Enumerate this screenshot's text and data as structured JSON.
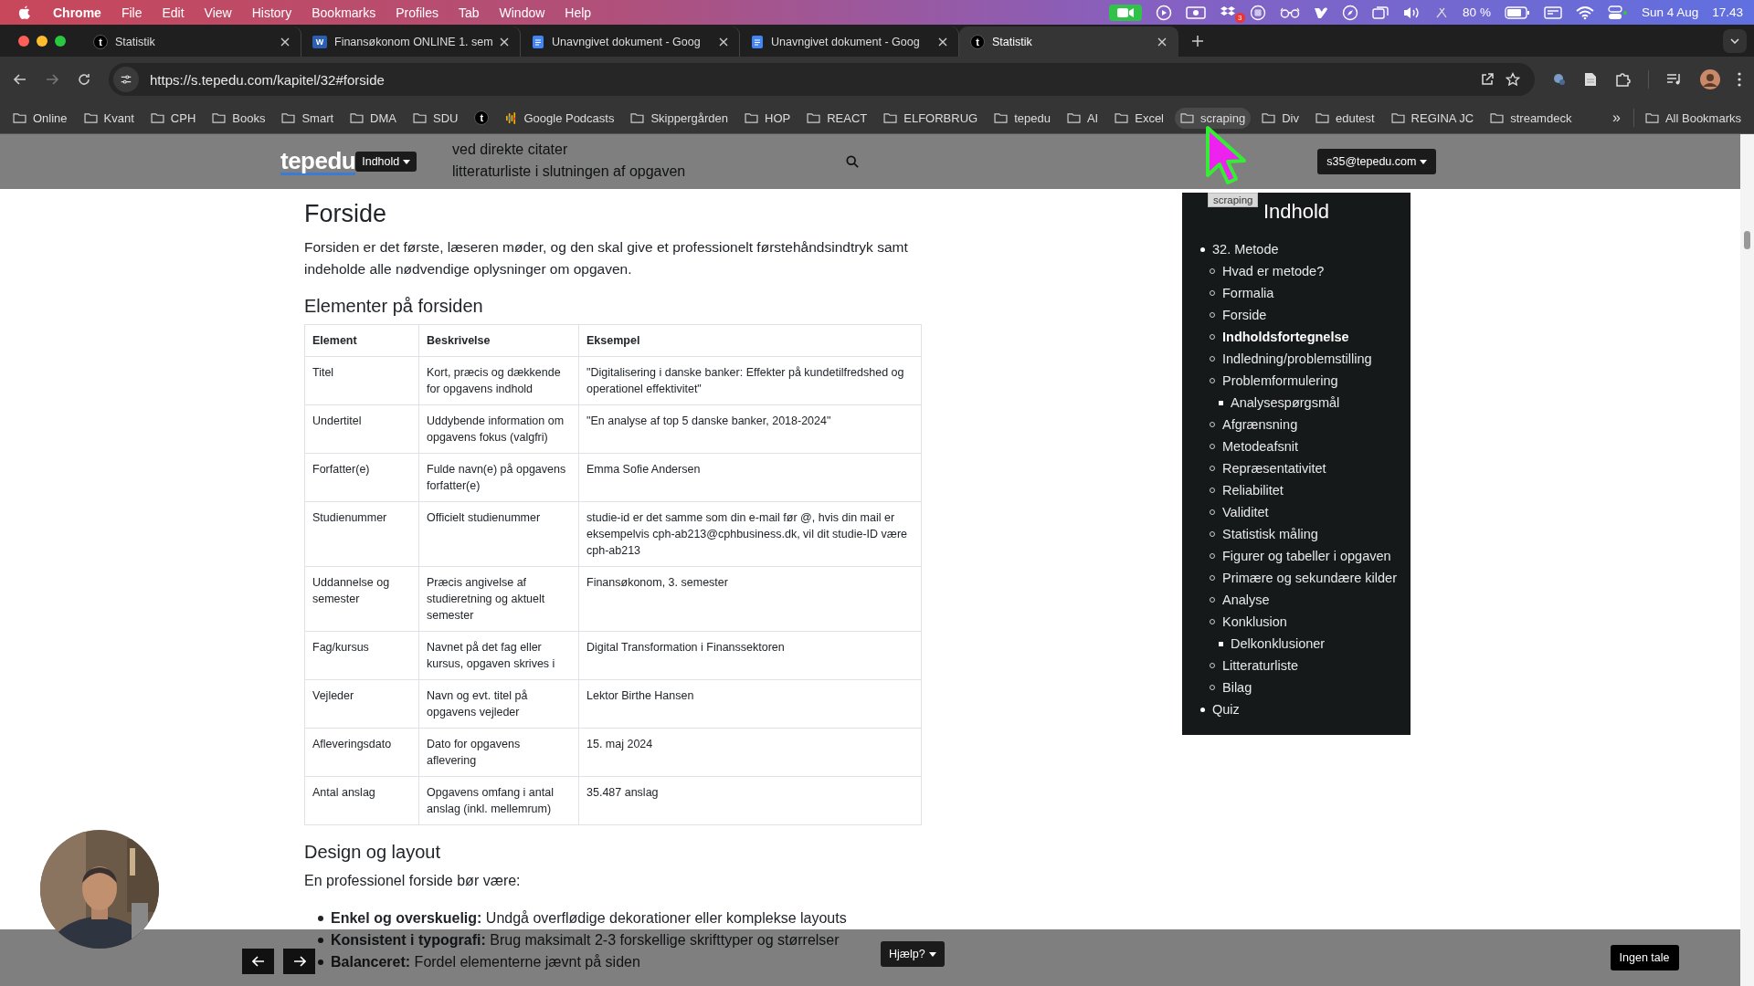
{
  "menu_bar": {
    "app": "Chrome",
    "menus": [
      "File",
      "Edit",
      "View",
      "History",
      "Bookmarks",
      "Profiles",
      "Tab",
      "Window",
      "Help"
    ],
    "badge": "3",
    "battery": "80 %",
    "date": "Sun 4 Aug",
    "time": "17.43"
  },
  "tabs": [
    {
      "title": "Statistik",
      "kind": "letter",
      "letter": "t",
      "selected": false
    },
    {
      "title": "Finansøkonom ONLINE 1. sem",
      "kind": "word",
      "letter": "W",
      "selected": false
    },
    {
      "title": "Unavngivet dokument - Goog",
      "kind": "docs",
      "selected": false
    },
    {
      "title": "Unavngivet dokument - Goog",
      "kind": "docs",
      "selected": false
    },
    {
      "title": "Statistik",
      "kind": "letter",
      "letter": "t",
      "selected": true
    }
  ],
  "toolbar": {
    "url": "https://s.tepedu.com/kapitel/32#forside"
  },
  "bookmarks": [
    {
      "label": "Online",
      "kind": "folder",
      "hovered": false
    },
    {
      "label": "Kvant",
      "kind": "folder",
      "hovered": false
    },
    {
      "label": "CPH",
      "kind": "folder",
      "hovered": false
    },
    {
      "label": "Books",
      "kind": "folder",
      "hovered": false
    },
    {
      "label": "Smart",
      "kind": "folder",
      "hovered": false
    },
    {
      "label": "DMA",
      "kind": "folder",
      "hovered": false
    },
    {
      "label": "SDU",
      "kind": "folder",
      "hovered": false
    },
    {
      "label": "t",
      "kind": "letter",
      "hovered": false
    },
    {
      "label": "Google Podcasts",
      "kind": "podcast",
      "hovered": false
    },
    {
      "label": "Skippergården",
      "kind": "folder",
      "hovered": false
    },
    {
      "label": "HOP",
      "kind": "folder",
      "hovered": false
    },
    {
      "label": "REACT",
      "kind": "folder",
      "hovered": false
    },
    {
      "label": "ELFORBRUG",
      "kind": "folder",
      "hovered": false
    },
    {
      "label": "tepedu",
      "kind": "folder",
      "hovered": false
    },
    {
      "label": "AI",
      "kind": "folder",
      "hovered": false
    },
    {
      "label": "Excel",
      "kind": "folder",
      "hovered": false
    },
    {
      "label": "scraping",
      "kind": "folder",
      "hovered": true
    },
    {
      "label": "Div",
      "kind": "folder",
      "hovered": false
    },
    {
      "label": "edutest",
      "kind": "folder",
      "hovered": false
    },
    {
      "label": "REGINA JC",
      "kind": "folder",
      "hovered": false
    },
    {
      "label": "streamdeck",
      "kind": "folder",
      "hovered": false
    }
  ],
  "bookmarks_overflow": "»",
  "all_bookmarks": "All Bookmarks",
  "tooltip": "scraping",
  "site_header": {
    "logo": "tepedu",
    "menu_button": "Indhold",
    "user_button": "s35@tepedu.com"
  },
  "article": {
    "top_bullets": [
      "ved direkte citater",
      "litteraturliste i slutningen af opgaven"
    ],
    "title": "Forside",
    "intro": "Forsiden er det første, læseren møder, og den skal give et professionelt førstehåndsindtryk samt indeholde alle nødvendige oplysninger om opgaven.",
    "table_heading": "Elementer på forsiden",
    "table": {
      "columns": [
        "Element",
        "Beskrivelse",
        "Eksempel"
      ],
      "rows": [
        [
          "Titel",
          "Kort, præcis og dækkende for opgavens indhold",
          "\"Digitalisering i danske banker: Effekter på kundetilfredshed og operationel effektivitet\""
        ],
        [
          "Undertitel",
          "Uddybende information om opgavens fokus (valgfri)",
          "\"En analyse af top 5 danske banker, 2018-2024\""
        ],
        [
          "Forfatter(e)",
          "Fulde navn(e) på opgavens forfatter(e)",
          "Emma Sofie Andersen"
        ],
        [
          "Studienummer",
          "Officielt studienummer",
          "studie-id er det samme som din e-mail før @, hvis din mail er eksempelvis cph-ab213@cphbusiness.dk, vil dit studie-ID være cph-ab213"
        ],
        [
          "Uddannelse og semester",
          "Præcis angivelse af studieretning og aktuelt semester",
          "Finansøkonom, 3. semester"
        ],
        [
          "Fag/kursus",
          "Navnet på det fag eller kursus, opgaven skrives i",
          "Digital Transformation i Finanssektoren"
        ],
        [
          "Vejleder",
          "Navn og evt. titel på opgavens vejleder",
          "Lektor Birthe Hansen"
        ],
        [
          "Afleveringsdato",
          "Dato for opgavens aflevering",
          "15. maj 2024"
        ],
        [
          "Antal anslag",
          "Opgavens omfang i antal anslag (inkl. mellemrum)",
          "35.487 anslag"
        ]
      ]
    },
    "design_heading": "Design og layout",
    "design_intro": "En professionel forside bør være:",
    "design_bullets": [
      "**Enkel og overskuelig:** Undgå overflødige dekorationer eller komplekse layouts",
      "**Konsistent i typografi:** Brug maksimalt 2-3 forskellige skrifttyper og størrelser",
      "**Balanceret:** Fordel elementerne jævnt på siden"
    ]
  },
  "toc": {
    "title": "Indhold",
    "items": [
      {
        "label": "32. Metode",
        "active": false,
        "children": [
          {
            "label": "Hvad er metode?",
            "active": false
          },
          {
            "label": "Formalia",
            "active": false
          },
          {
            "label": "Forside",
            "active": false
          },
          {
            "label": "Indholdsfortegnelse",
            "active": true
          },
          {
            "label": "Indledning/problemstilling",
            "active": false
          },
          {
            "label": "Problemformulering",
            "active": false,
            "children": [
              {
                "label": "Analysespørgsmål",
                "active": false
              }
            ]
          },
          {
            "label": "Afgrænsning",
            "active": false
          },
          {
            "label": "Metodeafsnit",
            "active": false
          },
          {
            "label": "Repræsentativitet",
            "active": false
          },
          {
            "label": "Reliabilitet",
            "active": false
          },
          {
            "label": "Validitet",
            "active": false
          },
          {
            "label": "Statistisk måling",
            "active": false
          },
          {
            "label": "Figurer og tabeller i opgaven",
            "active": false
          },
          {
            "label": "Primære og sekundære kilder",
            "active": false
          },
          {
            "label": "Analyse",
            "active": false
          },
          {
            "label": "Konklusion",
            "active": false,
            "children": [
              {
                "label": "Delkonklusioner",
                "active": false
              }
            ]
          },
          {
            "label": "Litteraturliste",
            "active": false
          },
          {
            "label": "Bilag",
            "active": false
          }
        ]
      },
      {
        "label": "Quiz",
        "active": false
      }
    ]
  },
  "footer": {
    "help_button": "Hjælp?",
    "speech_button": "Ingen tale"
  }
}
